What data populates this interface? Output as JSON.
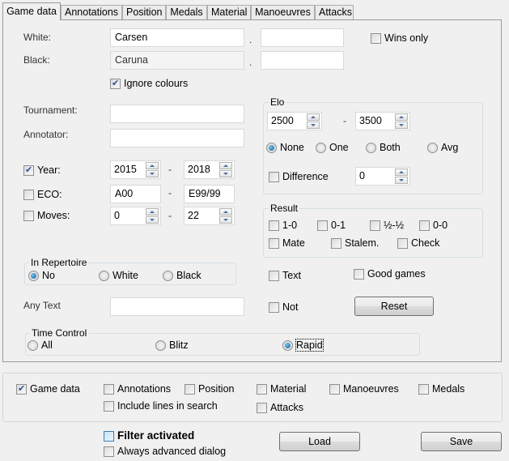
{
  "tabs": [
    {
      "label": "Game data",
      "active": true
    },
    {
      "label": "Annotations"
    },
    {
      "label": "Position"
    },
    {
      "label": "Medals"
    },
    {
      "label": "Material"
    },
    {
      "label": "Manoeuvres"
    },
    {
      "label": "Attacks"
    }
  ],
  "game_data": {
    "white_label": "White:",
    "white_value": "Carsen",
    "white_extra": "",
    "black_label": "Black:",
    "black_value": "Caruna",
    "black_extra": "",
    "dot": ".",
    "wins_only_label": "Wins only",
    "wins_only": false,
    "ignore_colours_label": "Ignore colours",
    "ignore_colours": true,
    "tournament_label": "Tournament:",
    "tournament_value": "",
    "annotator_label": "Annotator:",
    "annotator_value": "",
    "year_label": "Year:",
    "year_checked": true,
    "year_from": "2015",
    "year_to": "2018",
    "eco_label": "ECO:",
    "eco_checked": false,
    "eco_from": "A00",
    "eco_to": "E99/99",
    "moves_label": "Moves:",
    "moves_checked": false,
    "moves_from": "0",
    "moves_to": "22",
    "range_dash": "-",
    "elo": {
      "title": "Elo",
      "from": "2500",
      "to": "3500",
      "options": [
        "None",
        "One",
        "Both",
        "Avg"
      ],
      "selected": "None",
      "difference_label": "Difference",
      "difference_checked": false,
      "difference_value": "0"
    },
    "result": {
      "title": "Result",
      "options": [
        "1-0",
        "0-1",
        "½-½",
        "0-0",
        "Mate",
        "Stalem.",
        "Check"
      ]
    },
    "repertoire": {
      "title": "In Repertoire",
      "options": [
        "No",
        "White",
        "Black"
      ],
      "selected": "No"
    },
    "any_text_label": "Any Text",
    "any_text_value": "",
    "text_label": "Text",
    "not_label": "Not",
    "good_games_label": "Good games",
    "reset_label": "Reset",
    "time_control": {
      "title": "Time Control",
      "options": [
        "All",
        "Blitz",
        "Rapid"
      ],
      "selected": "Rapid"
    }
  },
  "search_in": {
    "game_data": "Game data",
    "annotations": "Annotations",
    "position": "Position",
    "material": "Material",
    "manoeuvres": "Manoeuvres",
    "medals": "Medals",
    "include_lines": "Include lines in search",
    "attacks": "Attacks"
  },
  "footer": {
    "filter_activated": "Filter activated",
    "always_advanced": "Always advanced dialog",
    "load": "Load",
    "save": "Save"
  }
}
